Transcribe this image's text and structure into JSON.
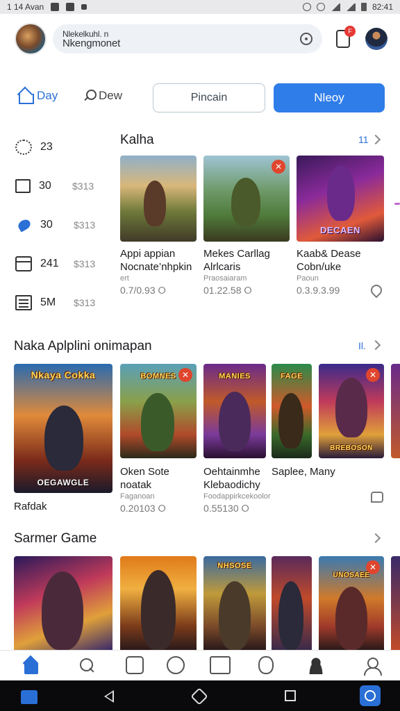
{
  "status_bar": {
    "time_left": "1 14 Avan",
    "time_right": "82:41"
  },
  "header": {
    "search_text_line1": "Nlekelkuhl. n",
    "search_text_line2": "Nkengmonet",
    "notification_count": "F"
  },
  "top_nav": {
    "day_label": "Day",
    "dew_label": "Dew",
    "outline_button": "Pincain",
    "primary_button": "Nleoy"
  },
  "stats": [
    {
      "icon": "gear-icon",
      "value": "23",
      "price": ""
    },
    {
      "icon": "square-icon",
      "value": "30",
      "price": "$313"
    },
    {
      "icon": "bird-icon",
      "value": "30",
      "price": "$313"
    },
    {
      "icon": "wallet-icon",
      "value": "241",
      "price": "$313"
    },
    {
      "icon": "list-icon",
      "value": "5M",
      "price": "$313"
    }
  ],
  "section1": {
    "title": "Kalha",
    "see_more": "11",
    "cards": [
      {
        "title_line1": "Appi appian",
        "title_line2": "Nocnate’nhpkin",
        "sub": "ert",
        "price": "0.7/0.93 ⭘"
      },
      {
        "title_line1": "Mekes Carllag",
        "title_line2": "Alrlcaris",
        "sub": "Praosaiaram",
        "price": "01.22.58 ⭘"
      },
      {
        "title_line1": "Kaab& Dease",
        "title_line2": "Cobn/uke",
        "sub": "Paoun",
        "price": "0.3.9.3.99",
        "banner": "DECAEN"
      }
    ]
  },
  "section2": {
    "title": "Naka Aplplini onimapan",
    "see_more": "Il.",
    "cards": [
      {
        "title_line1": "Rafdak",
        "banner": "Nkaya Cokka",
        "footer": "OEGAWGLE"
      },
      {
        "title_line1": "Oken Sote",
        "title_line2": "noatak",
        "sub": "Faganoan",
        "price": "0.20103 ⭘",
        "banner": "BOMNES"
      },
      {
        "title_line1": "Oehtainmhe",
        "title_line2": "Klebaodichy",
        "sub": "Foodappirkcekoolor",
        "price": "0.55130 ⭘",
        "banner": "MANIES"
      },
      {
        "title_line1": "Saplee, Many",
        "banner": "FAGE"
      },
      {
        "title_line1": "",
        "banner": "BREBOSON"
      }
    ]
  },
  "section3": {
    "title": "Sarmer Game",
    "cards": [
      {
        "banner": ""
      },
      {
        "banner": ""
      },
      {
        "banner": "NHSOSE"
      },
      {
        "banner": ""
      },
      {
        "banner": "UNOSAEE"
      }
    ]
  },
  "bottom_nav": [
    "home-icon",
    "search-icon",
    "box-icon",
    "compass-icon",
    "frame-icon",
    "watch-icon",
    "avatar-icon",
    "profile-icon"
  ],
  "colors": {
    "accent": "#2f7de8",
    "badge": "#e0452e"
  }
}
